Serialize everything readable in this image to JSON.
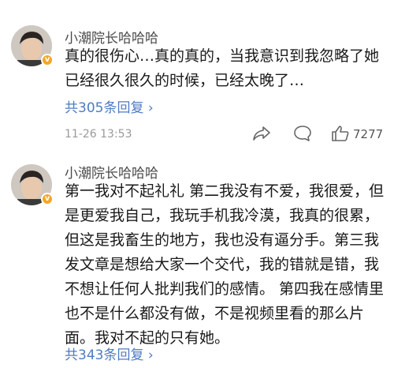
{
  "comments": [
    {
      "username": "小潮院长哈哈哈",
      "text": "真的很伤心…真的真的，当我意识到我忽略了她已经很久很久的时候，已经太晚了…",
      "reply_link": "共305条回复 ›",
      "time": "11-26 13:53",
      "like_count": "7277",
      "verified_badge": "v"
    },
    {
      "username": "小潮院长哈哈哈",
      "text": "第一我对不起礼礼 第二我没有不爱，我很爱，但是更爱我自己，我玩手机我冷漠，我真的很累，但这是我畜生的地方，我也没有逼分手。第三我发文章是想给大家一个交代，我的错就是错，我不想让任何人批判我们的感情。 第四我在感情里也不是什么都没有做，不是视频里看的那么片面。我对不起的只有她。",
      "reply_link": "共343条回复 ›",
      "verified_badge": "v"
    }
  ],
  "icons": {
    "share": "share-icon",
    "comment": "comment-icon",
    "like": "thumbs-up-icon"
  },
  "colors": {
    "link": "#4f7cc1",
    "badge": "#f5a623"
  }
}
